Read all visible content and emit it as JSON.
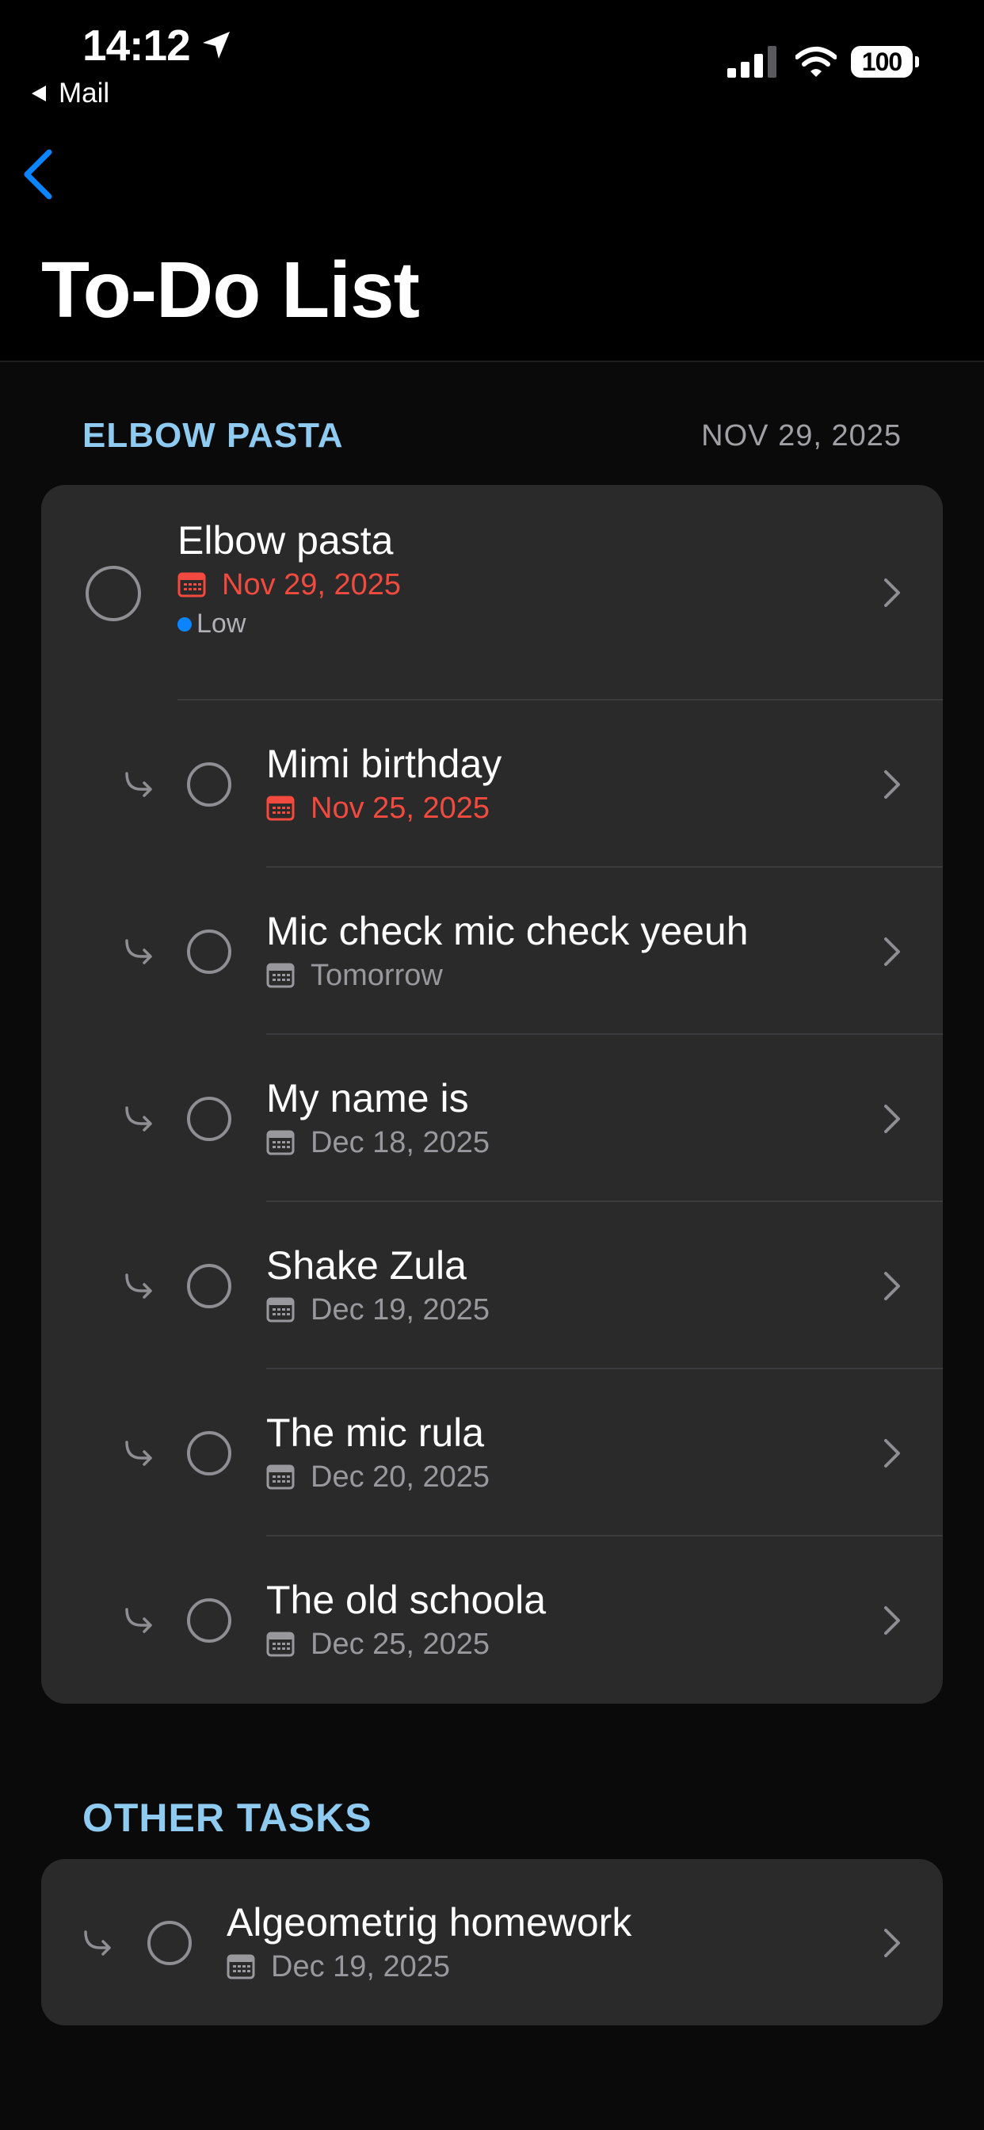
{
  "status_bar": {
    "time": "14:12",
    "back_app": "Mail",
    "battery": "100"
  },
  "page": {
    "title": "To-Do List"
  },
  "sections": [
    {
      "title": "ELBOW PASTA",
      "date": "NOV 29, 2025",
      "parent": {
        "title": "Elbow pasta",
        "date": "Nov 29, 2025",
        "priority": "Low"
      },
      "subtasks": [
        {
          "title": "Mimi birthday",
          "date": "Nov 25, 2025"
        },
        {
          "title": "Mic check mic check yeeuh",
          "date": "Tomorrow"
        },
        {
          "title": "My name is",
          "date": "Dec 18, 2025"
        },
        {
          "title": "Shake Zula",
          "date": "Dec 19, 2025"
        },
        {
          "title": "The mic rula",
          "date": "Dec 20, 2025"
        },
        {
          "title": "The old schoola",
          "date": "Dec 25, 2025"
        }
      ]
    },
    {
      "title": "OTHER TASKS",
      "tasks": [
        {
          "title": "Algeometrig homework",
          "date": "Dec 19, 2025"
        }
      ]
    }
  ],
  "colors": {
    "accent_blue": "#0a84ff",
    "section_header": "#8fcaf0",
    "overdue_red": "#f24a3e",
    "card_bg": "#2a2a2b"
  },
  "icons": {
    "location": "location-arrow-icon",
    "back": "chevron-left-icon",
    "calendar": "calendar-icon",
    "subtask": "subtask-arrow-icon",
    "chevron": "chevron-right-icon"
  }
}
